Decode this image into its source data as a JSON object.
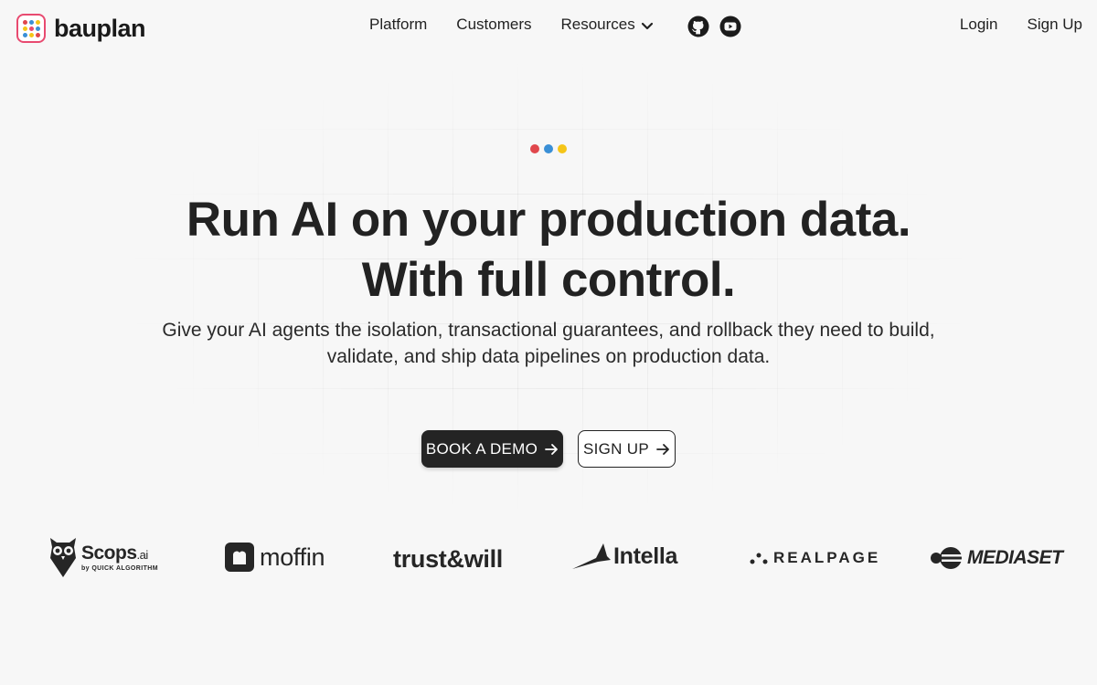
{
  "header": {
    "logo_text": "bauplan",
    "nav": [
      {
        "label": "Platform"
      },
      {
        "label": "Customers"
      },
      {
        "label": "Resources",
        "has_dropdown": true
      }
    ],
    "social_icons": [
      "github-icon",
      "youtube-icon"
    ],
    "login_label": "Login",
    "signup_label": "Sign Up"
  },
  "hero": {
    "title_line1": "Run AI on your production data.",
    "title_line2": "With full control.",
    "subtitle": "Give your AI agents the isolation, transactional guarantees, and rollback they need to build, validate, and ship data pipelines on production data.",
    "dot_colors": [
      "#e0474c",
      "#3a8fd6",
      "#f5c518"
    ],
    "cta_primary": "BOOK A DEMO",
    "cta_secondary": "SIGN UP"
  },
  "logos": {
    "scops_main": "Scops",
    "scops_suffix": ".ai",
    "scops_by": "by QUICK ALGORITHM",
    "moffin": "moffin",
    "trust_a": "trust",
    "trust_amp": "&",
    "trust_b": "will",
    "intella": "Intella",
    "realpage": "REALPAGE",
    "mediaset": "MEDIASET"
  },
  "colors": {
    "background": "#f7f7f7",
    "primary_button": "#242424",
    "logo_border": "#e84a70"
  }
}
